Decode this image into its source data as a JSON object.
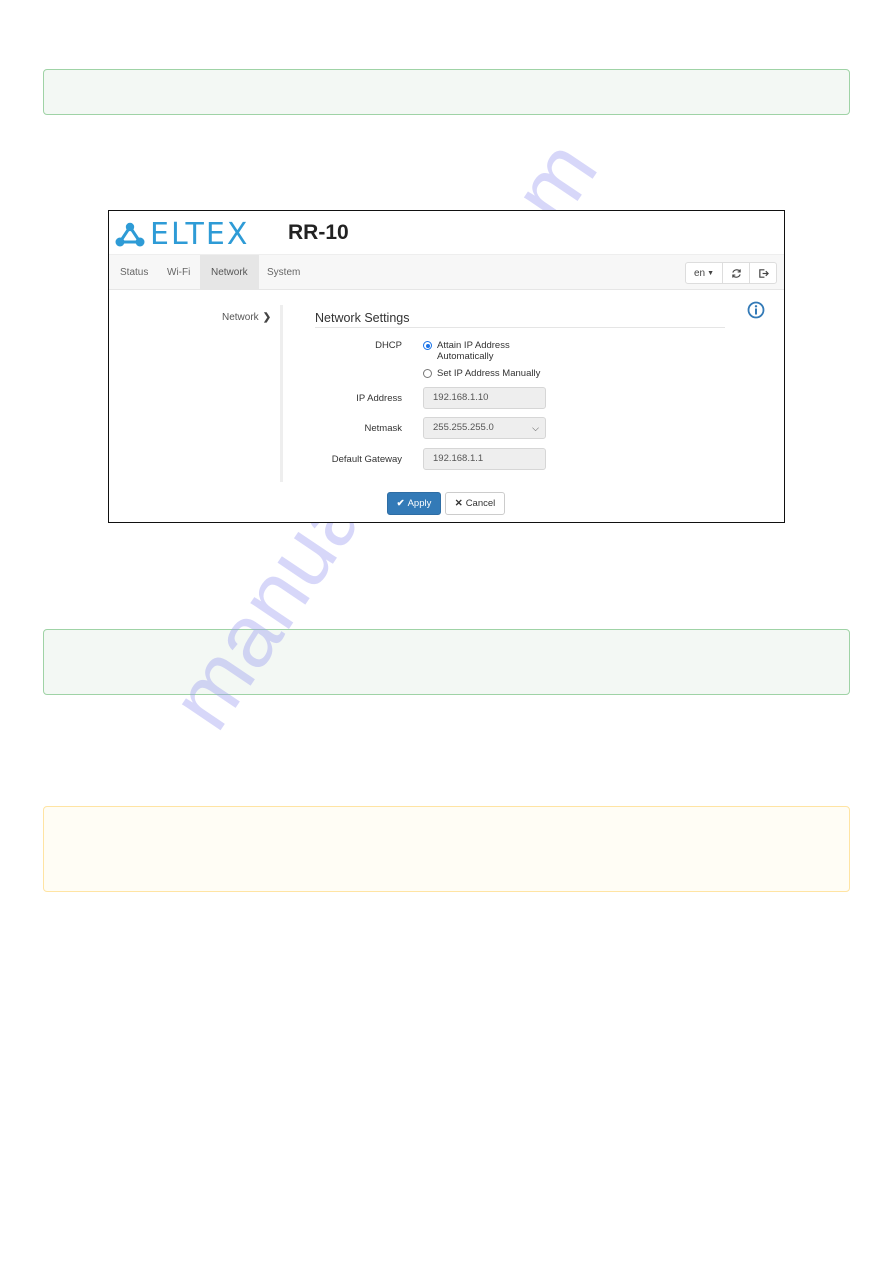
{
  "watermark": "manualshive.com",
  "notes": [
    {
      "type": "success",
      "color": "#9fd3a6",
      "text": ""
    },
    {
      "type": "success",
      "color": "#9fd3a6",
      "text": ""
    },
    {
      "type": "warning",
      "color": "#ffe4a3",
      "text": ""
    }
  ],
  "screenshot": {
    "brand": {
      "logo_text": "ELTEX",
      "logo_color": "#2e9bd6",
      "model": "RR-10"
    },
    "nav": {
      "items": [
        {
          "label": "Status",
          "active": false
        },
        {
          "label": "Wi-Fi",
          "active": false
        },
        {
          "label": "Network",
          "active": true
        },
        {
          "label": "System",
          "active": false
        }
      ],
      "language": "en",
      "language_caret_icon": "caret-down-icon",
      "refresh_icon": "refresh-icon",
      "logout_icon": "logout-icon"
    },
    "sidebar": {
      "items": [
        {
          "label": "Network",
          "icon": "chevron-right-icon"
        }
      ]
    },
    "section": {
      "title": "Network Settings",
      "info_icon": "info-icon",
      "dhcp": {
        "label": "DHCP",
        "options": [
          {
            "label": "Attain IP Address",
            "label_line2": "Automatically",
            "checked": true
          },
          {
            "label": "Set IP Address Manually",
            "checked": false
          }
        ]
      },
      "ip_address": {
        "label": "IP Address",
        "value": "192.168.1.10"
      },
      "netmask": {
        "label": "Netmask",
        "value": "255.255.255.0"
      },
      "gateway": {
        "label": "Default Gateway",
        "value": "192.168.1.1"
      }
    },
    "actions": {
      "apply_label": "Apply",
      "apply_color": "#337ab7",
      "cancel_label": "Cancel"
    }
  }
}
